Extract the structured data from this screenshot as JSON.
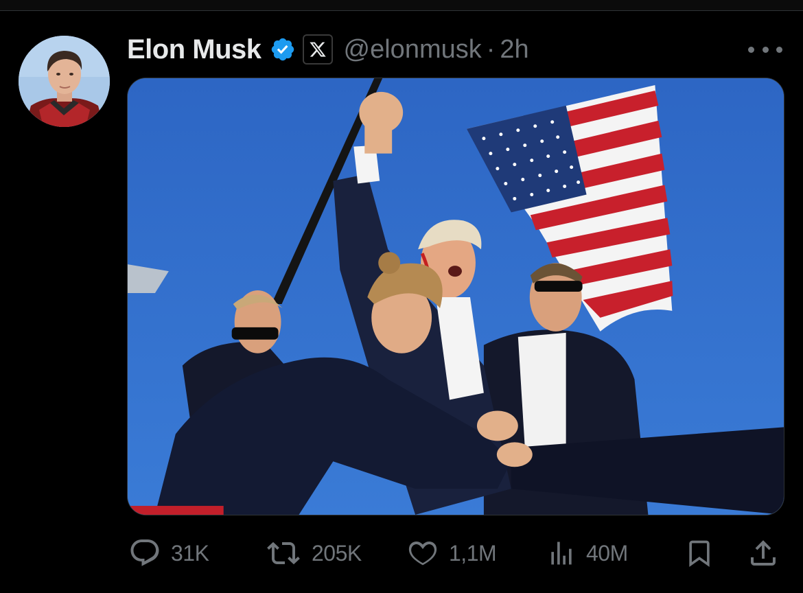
{
  "author": {
    "display_name": "Elon Musk",
    "handle": "@elonmusk",
    "separator": "·",
    "time": "2h",
    "verified": true,
    "verified_color": "#1d9bf0"
  },
  "post": {
    "media": {
      "type": "photo",
      "alt": "Photo of Donald Trump raising a fist with a U.S. flag and security agents"
    }
  },
  "metrics": {
    "replies": "31K",
    "reposts": "205K",
    "likes": "1,1M",
    "views": "40M"
  },
  "icons": {
    "reply": "speech-bubble-icon",
    "repost": "repost-arrows-icon",
    "like": "heart-icon",
    "views": "bar-chart-icon",
    "bookmark": "bookmark-icon",
    "share": "share-upload-icon",
    "more": "more-dots-icon",
    "badge": "x-logo-icon"
  },
  "colors": {
    "background": "#000000",
    "text_primary": "#e7e9ea",
    "text_secondary": "#71767b"
  }
}
